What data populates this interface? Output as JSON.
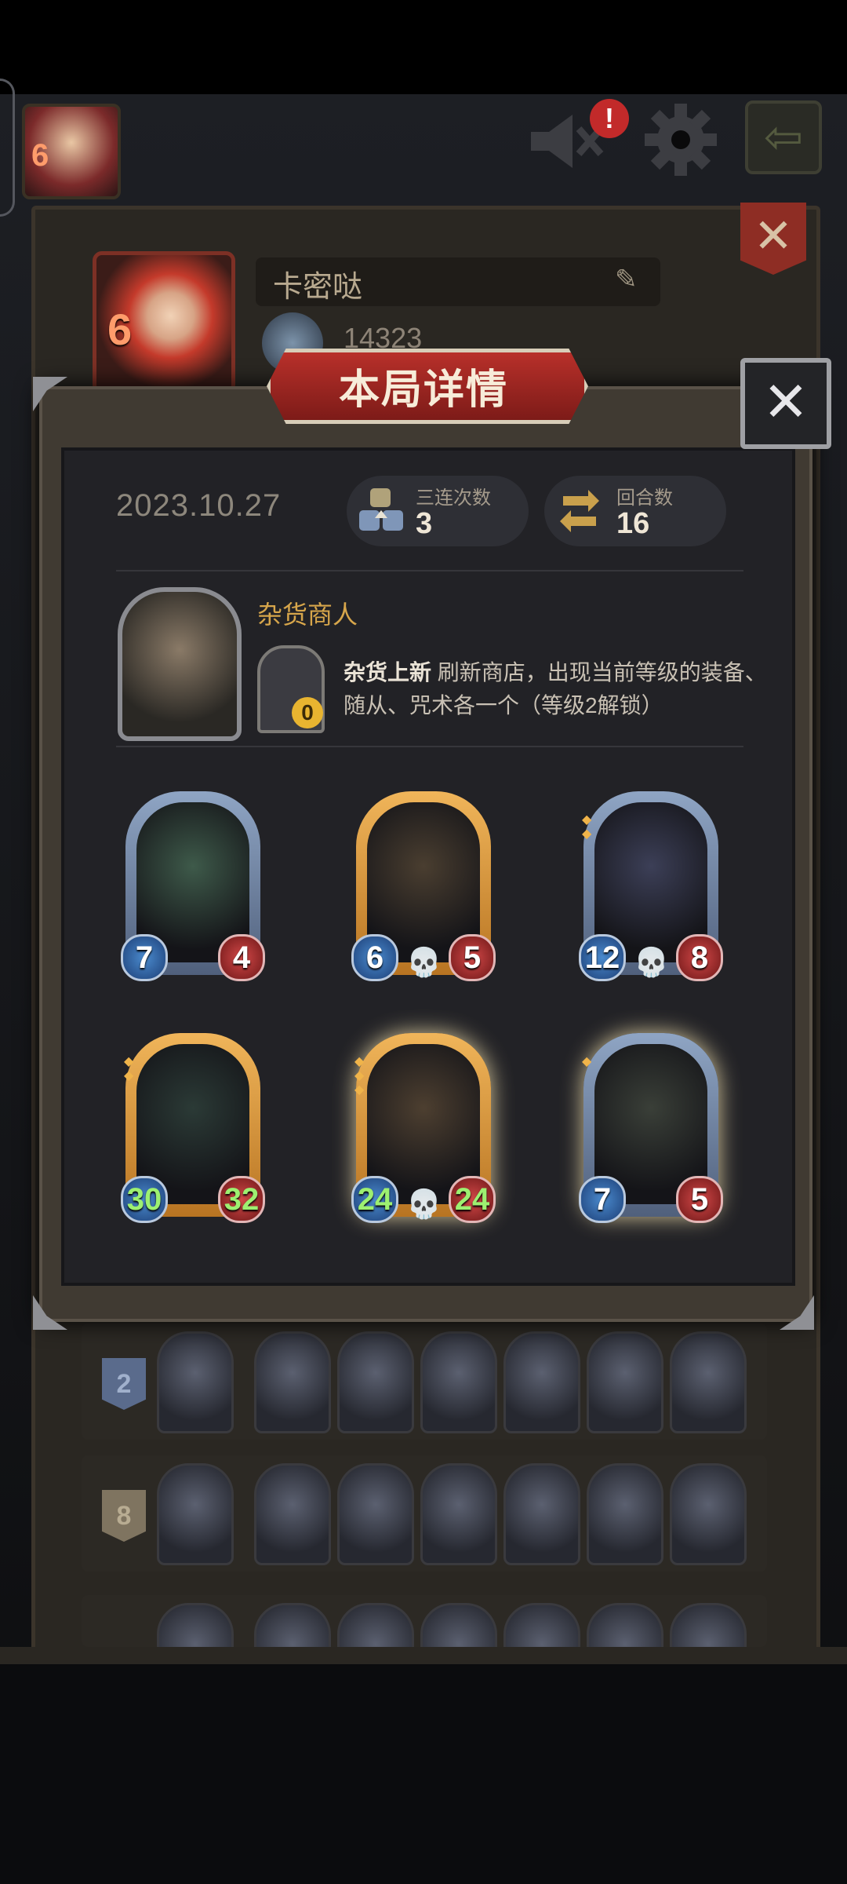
{
  "player": {
    "level": "6",
    "name": "卡密哒",
    "score": "14323"
  },
  "topbar": {
    "alert_badge": "!"
  },
  "dialog": {
    "title": "本局详情",
    "date": "2023.10.27",
    "stats": [
      {
        "label": "三连次数",
        "value": "3"
      },
      {
        "label": "回合数",
        "value": "16"
      }
    ]
  },
  "merchant": {
    "name": "杂货商人",
    "skill_cost": "0",
    "skill_name": "杂货上新",
    "skill_desc": "刷新商店，出现当前等级的装备、随从、咒术各一个（等级2解锁）"
  },
  "cards": [
    {
      "attack": "7",
      "health": "4",
      "frame": "blue",
      "art_color": "#3e5a4a"
    },
    {
      "attack": "6",
      "health": "5",
      "frame": "gold",
      "art_color": "#4a3e30"
    },
    {
      "attack": "12",
      "health": "8",
      "frame": "blue",
      "art_color": "#3c3f57"
    },
    {
      "attack": "30",
      "health": "32",
      "frame": "gold",
      "art_color": "#2b3a36"
    },
    {
      "attack": "24",
      "health": "24",
      "frame": "gold",
      "art_color": "#4d3f30"
    },
    {
      "attack": "7",
      "health": "5",
      "frame": "blue",
      "art_color": "#3a3f38"
    }
  ],
  "history": [
    {
      "rank": "2"
    },
    {
      "rank": "8"
    }
  ],
  "colors": {
    "title_banner": "#9e2824",
    "gold": "#d7a64b",
    "attack": "#2f64a8",
    "health": "#a82f2f"
  }
}
